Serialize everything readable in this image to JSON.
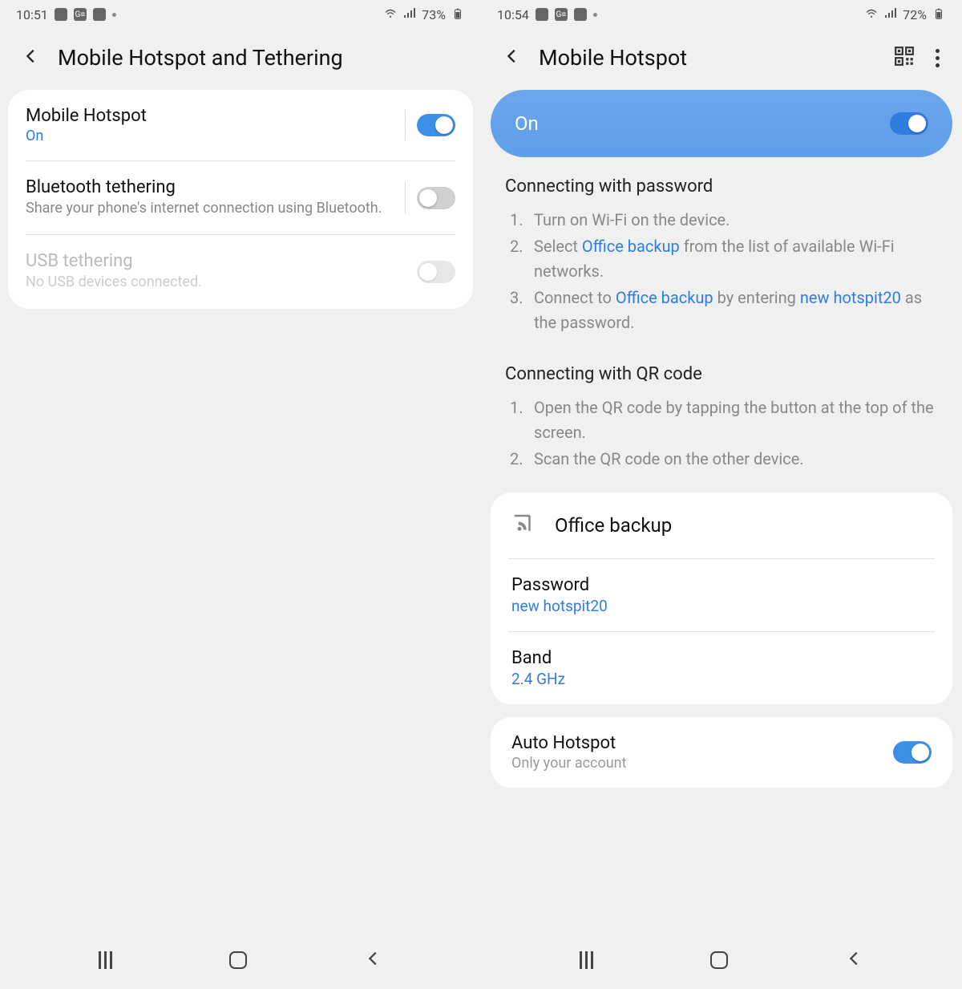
{
  "left": {
    "status": {
      "time": "10:51",
      "battery": "73%"
    },
    "title": "Mobile Hotspot and Tethering",
    "items": [
      {
        "title": "Mobile Hotspot",
        "sub": "On",
        "subColor": "blue",
        "toggle": "on",
        "showSep": true
      },
      {
        "title": "Bluetooth tethering",
        "sub": "Share your phone's internet connection using Bluetooth.",
        "subColor": "gray",
        "toggle": "off",
        "showSep": true
      },
      {
        "title": "USB tethering",
        "sub": "No USB devices connected.",
        "subColor": "gray",
        "toggle": "off",
        "disabled": true,
        "showSep": false
      }
    ]
  },
  "right": {
    "status": {
      "time": "10:54",
      "battery": "72%"
    },
    "title": "Mobile Hotspot",
    "bannerLabel": "On",
    "passwordSection": {
      "heading": "Connecting with password",
      "step1": "Turn on Wi-Fi on the device.",
      "step2_a": "Select ",
      "step2_b": "Office backup",
      "step2_c": " from the list of available Wi-Fi networks.",
      "step3_a": "Connect to ",
      "step3_b": "Office backup",
      "step3_c": " by entering ",
      "step3_d": "new hotspit20",
      "step3_e": " as the password."
    },
    "qrSection": {
      "heading": "Connecting with QR code",
      "step1": "Open the QR code by tapping the button at the top of the screen.",
      "step2": "Scan the QR code on the other device."
    },
    "config": {
      "name": "Office backup",
      "passwordLabel": "Password",
      "passwordValue": "new hotspit20",
      "bandLabel": "Band",
      "bandValue": "2.4 GHz"
    },
    "auto": {
      "title": "Auto Hotspot",
      "sub": "Only your account"
    }
  }
}
